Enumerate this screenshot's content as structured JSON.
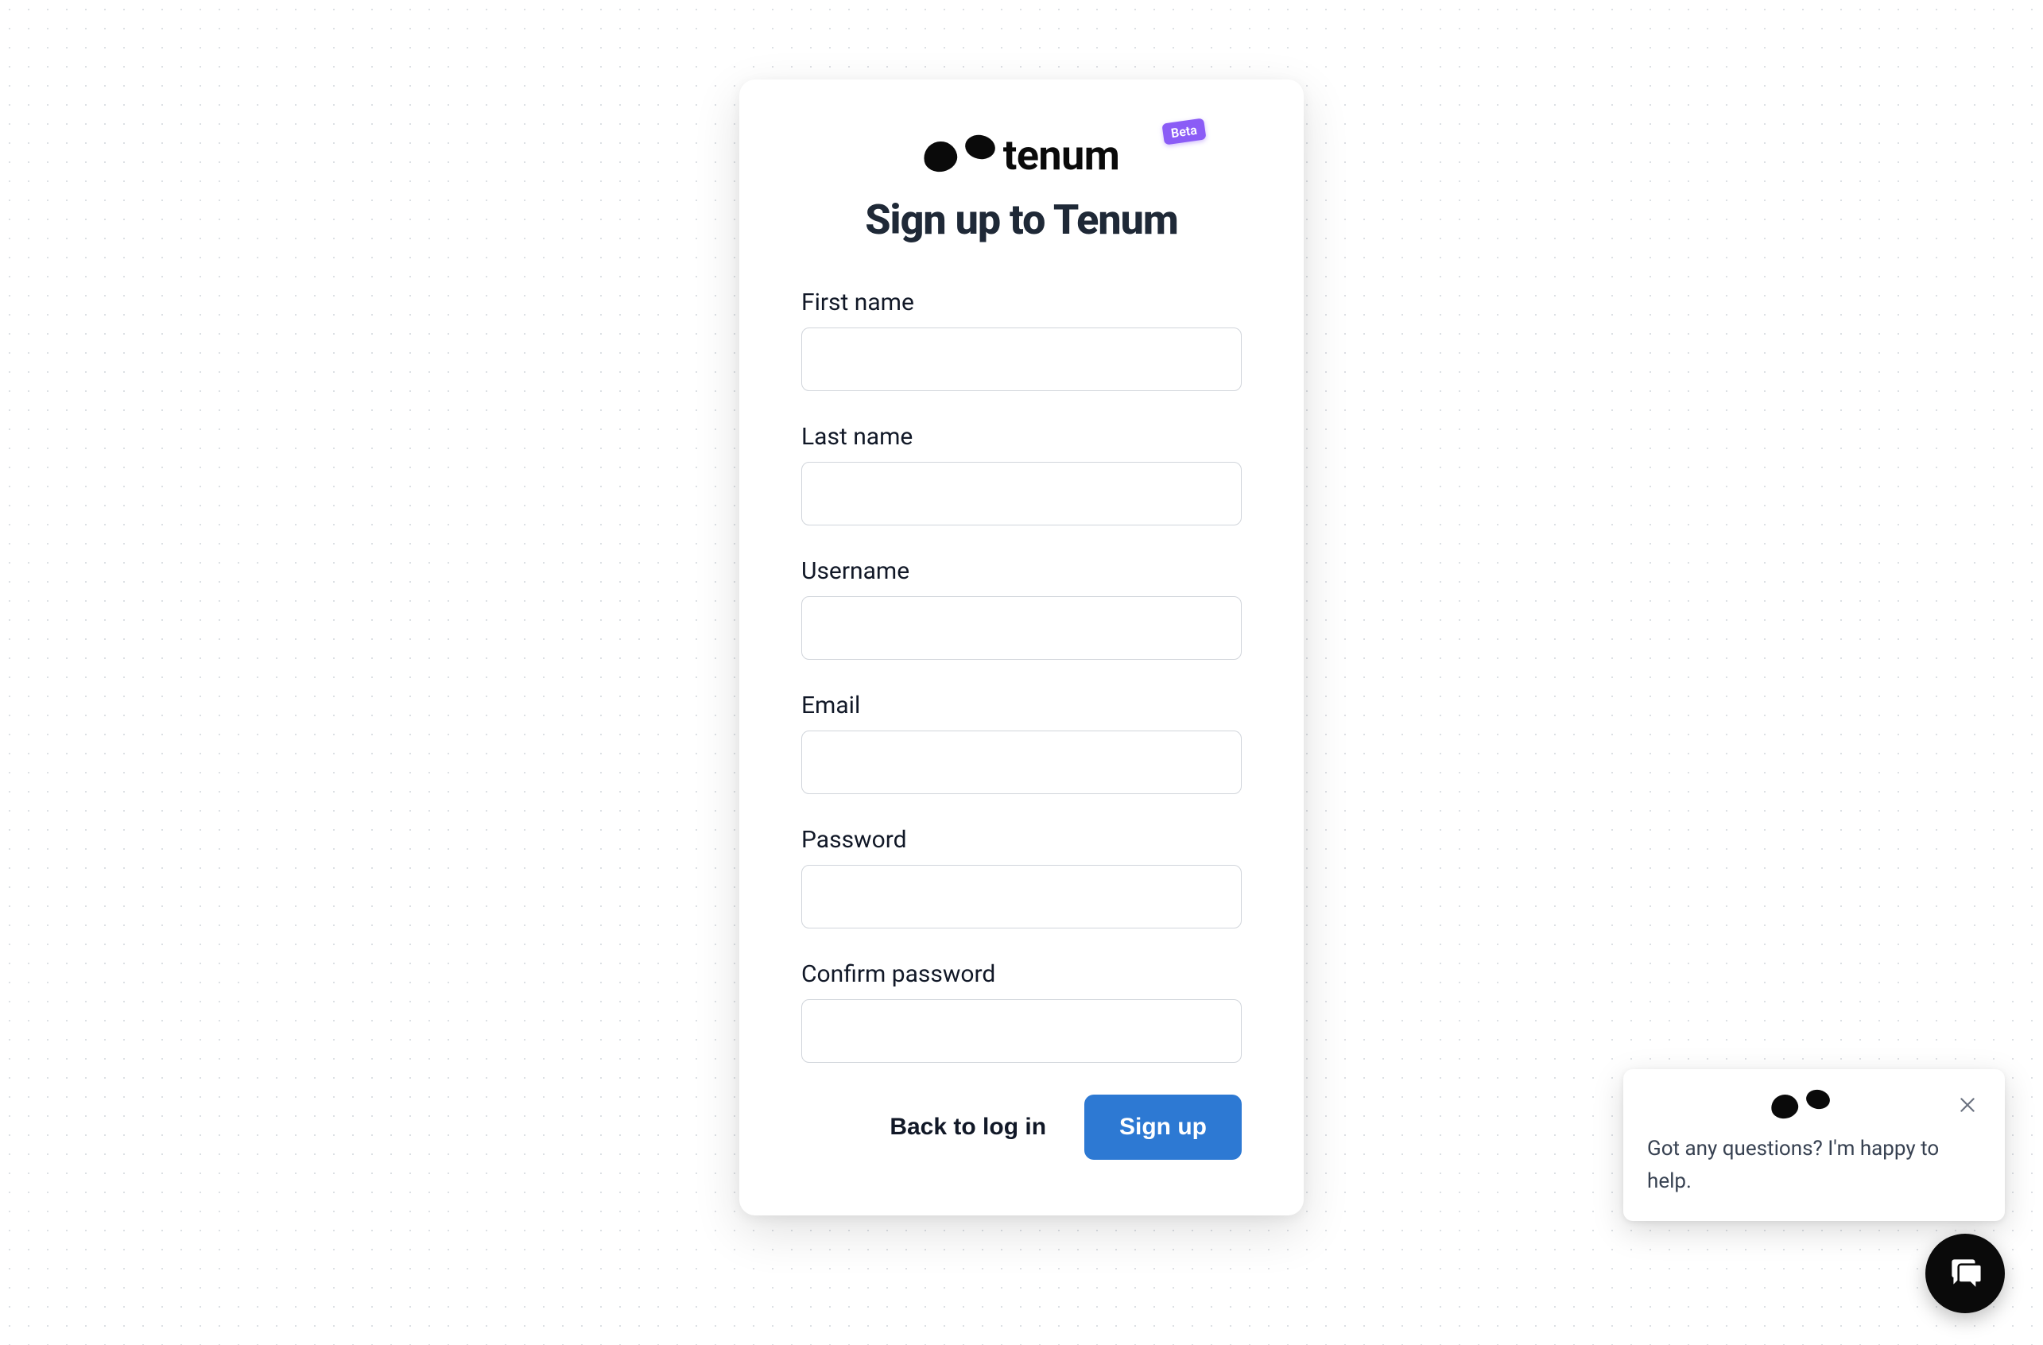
{
  "brand": {
    "name": "tenum",
    "badge": "Beta"
  },
  "card": {
    "title": "Sign up to Tenum"
  },
  "fields": {
    "first_name": {
      "label": "First name",
      "value": ""
    },
    "last_name": {
      "label": "Last name",
      "value": ""
    },
    "username": {
      "label": "Username",
      "value": ""
    },
    "email": {
      "label": "Email",
      "value": ""
    },
    "password": {
      "label": "Password",
      "value": ""
    },
    "confirm_password": {
      "label": "Confirm password",
      "value": ""
    }
  },
  "actions": {
    "back_label": "Back to log in",
    "submit_label": "Sign up"
  },
  "chat": {
    "message": "Got any questions? I'm happy to help."
  }
}
